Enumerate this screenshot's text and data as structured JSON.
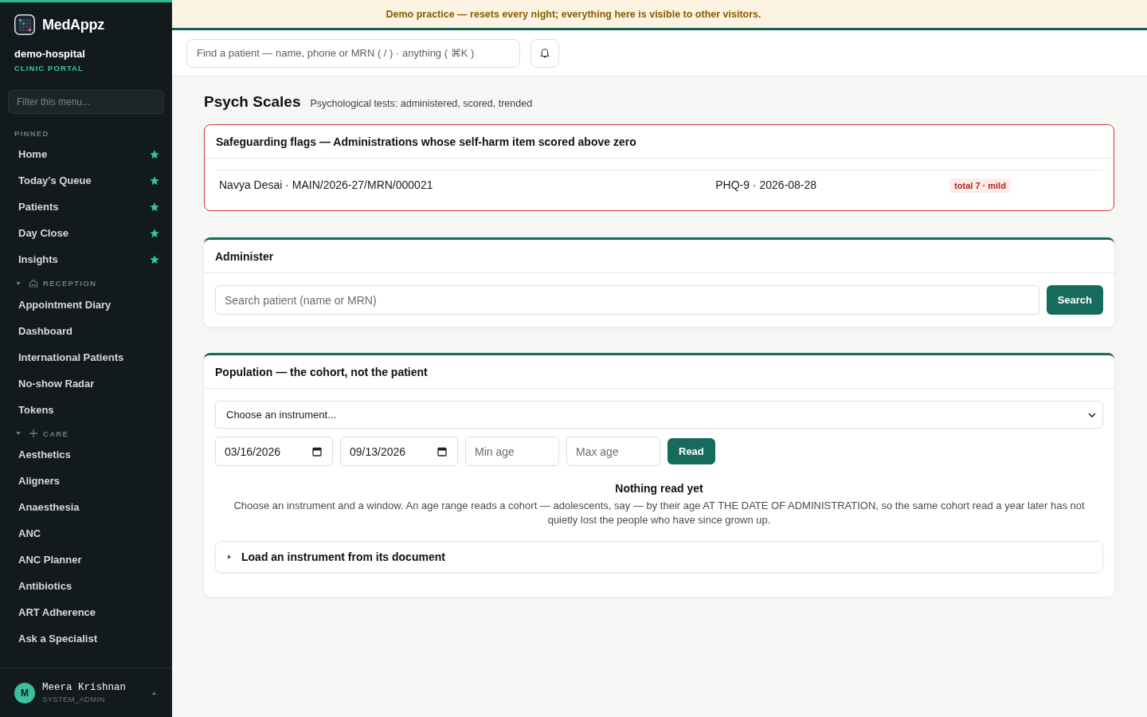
{
  "sidebar": {
    "brand": "MedAppz",
    "organization": "demo-hospital",
    "portal": "CLINIC PORTAL",
    "filter": {
      "placeholder": "Filter this menu..."
    },
    "sections": [
      {
        "kind": "pinned",
        "title": "PINNED",
        "items": [
          {
            "label": "Home",
            "starred": true
          },
          {
            "label": "Today's Queue",
            "starred": true
          },
          {
            "label": "Patients",
            "starred": true
          },
          {
            "label": "Day Close",
            "starred": true
          },
          {
            "label": "Insights",
            "starred": true
          }
        ]
      },
      {
        "kind": "group",
        "title": "RECEPTION",
        "expanded": true,
        "items": [
          {
            "label": "Appointment Diary",
            "starred": false
          },
          {
            "label": "Dashboard",
            "starred": false
          },
          {
            "label": "International Patients",
            "starred": false
          },
          {
            "label": "No-show Radar",
            "starred": false
          },
          {
            "label": "Tokens",
            "starred": false
          }
        ]
      },
      {
        "kind": "group",
        "title": "CARE",
        "expanded": true,
        "items": [
          {
            "label": "Aesthetics",
            "starred": false
          },
          {
            "label": "Aligners",
            "starred": false
          },
          {
            "label": "Anaesthesia",
            "starred": false
          },
          {
            "label": "ANC",
            "starred": false
          },
          {
            "label": "ANC Planner",
            "starred": false
          },
          {
            "label": "Antibiotics",
            "starred": false
          },
          {
            "label": "ART Adherence",
            "starred": false
          },
          {
            "label": "Ask a Specialist",
            "starred": false
          }
        ]
      }
    ],
    "user": {
      "initial": "M",
      "name": "Meera Krishnan",
      "role": "SYSTEM_ADMIN"
    }
  },
  "banner": "Demo practice — resets every night; everything here is visible to other visitors.",
  "topbar": {
    "search": {
      "placeholder": "Find a patient — name, phone or MRN ( / ) · anything ( ⌘K )"
    }
  },
  "page": {
    "title": "Psych Scales",
    "subtitle": "Psychological tests: administered, scored, trended"
  },
  "safeguarding": {
    "title": "Safeguarding flags — Administrations whose self-harm item scored above zero",
    "rows": [
      {
        "patient": "Navya Desai · MAIN/2026-27/MRN/000021",
        "administration": "PHQ-9 · 2026-08-28",
        "result": "total 7 · mild"
      }
    ]
  },
  "administer": {
    "title": "Administer",
    "search": {
      "placeholder": "Search patient (name or MRN)"
    },
    "button": "Search"
  },
  "population": {
    "title": "Population — the cohort, not the patient",
    "instrument": {
      "value": "Choose an instrument..."
    },
    "date_from": {
      "value": "03/16/2026"
    },
    "date_to": {
      "value": "09/13/2026"
    },
    "min_age": {
      "placeholder": "Min age"
    },
    "max_age": {
      "placeholder": "Max age"
    },
    "button": "Read",
    "empty_title": "Nothing read yet",
    "empty_text": "Choose an instrument and a window. An age range reads a cohort — adolescents, say — by their age AT THE DATE OF ADMINISTRATION, so the same cohort read a year later has not quietly lost the people who have since grown up.",
    "loader": {
      "label": "Load an instrument from its document",
      "expanded": false
    }
  }
}
